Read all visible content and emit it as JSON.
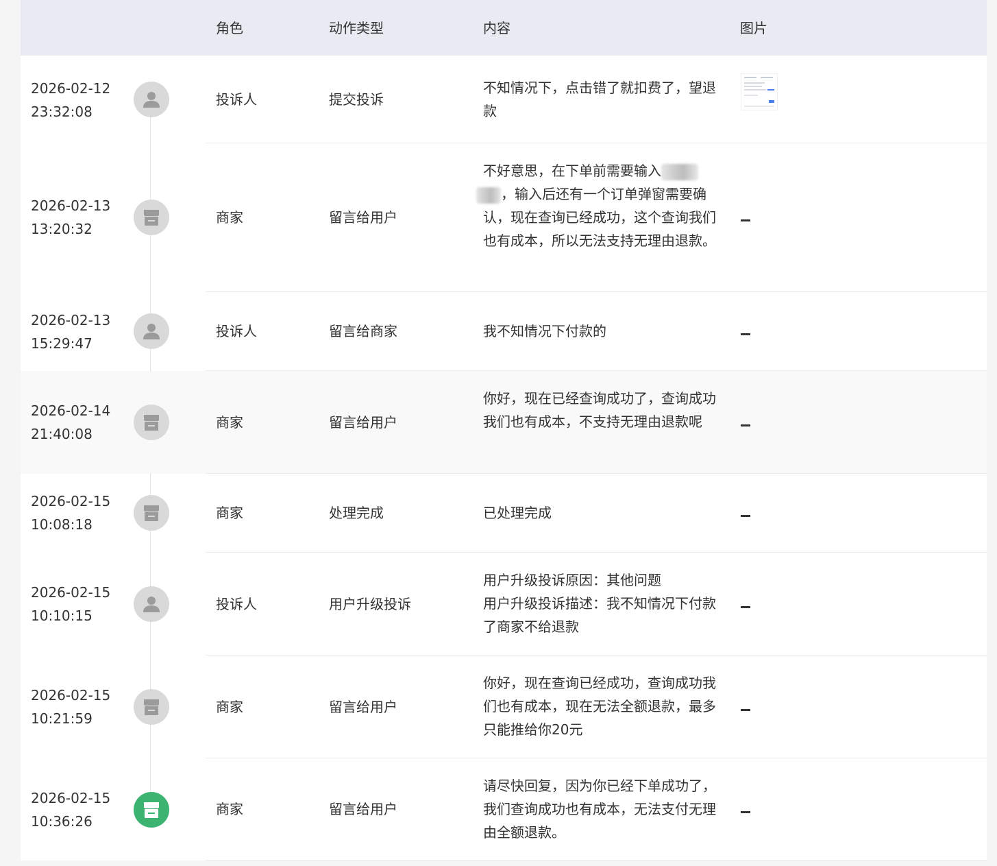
{
  "table": {
    "headers": [
      "角色",
      "动作类型",
      "内容",
      "图片"
    ]
  },
  "rows": [
    {
      "date": "2026-02-12",
      "time": "23:32:08",
      "avatar": "user-icon",
      "role": "投诉人",
      "action": "提交投诉",
      "content": "不知情况下，点击错了就扣费了，望退款",
      "image": "thumbnail"
    },
    {
      "date": "2026-02-13",
      "time": "13:20:32",
      "avatar": "store-icon",
      "role": "商家",
      "action": "留言给用户",
      "content_before": "不好意思，在下单前需要输入",
      "content_after": "，输入后还有一个订单弹窗需要确认，现在查询已经成功，这个查询我们也有成本，所以无法支持无理由退款。",
      "image": "–"
    },
    {
      "date": "2026-02-13",
      "time": "15:29:47",
      "avatar": "user-icon",
      "role": "投诉人",
      "action": "留言给商家",
      "content": "我不知情况下付款的",
      "image": "–"
    },
    {
      "date": "2026-02-14",
      "time": "21:40:08",
      "avatar": "store-icon",
      "role": "商家",
      "action": "留言给用户",
      "content": "你好，现在已经查询成功了，查询成功我们也有成本，不支持无理由退款呢",
      "image": "–"
    },
    {
      "date": "2026-02-15",
      "time": "10:08:18",
      "avatar": "store-icon",
      "role": "商家",
      "action": "处理完成",
      "content": "已处理完成",
      "image": "–"
    },
    {
      "date": "2026-02-15",
      "time": "10:10:15",
      "avatar": "user-icon",
      "role": "投诉人",
      "action": "用户升级投诉",
      "content_line1": "用户升级投诉原因：其他问题",
      "content_line2": "用户升级投诉描述：我不知情况下付款了商家不给退款",
      "image": "–"
    },
    {
      "date": "2026-02-15",
      "time": "10:21:59",
      "avatar": "store-icon",
      "role": "商家",
      "action": "留言给用户",
      "content": "你好，现在查询已经成功，查询成功我们也有成本，现在无法全额退款，最多只能推给你20元",
      "image": "–"
    },
    {
      "date": "2026-02-15",
      "time": "10:36:26",
      "avatar": "store-icon-active",
      "role": "商家",
      "action": "留言给用户",
      "content": "请尽快回复，因为你已经下单成功了，我们查询成功也有成本，无法支付无理由全额退款。",
      "image": "–"
    }
  ],
  "colors": {
    "header_bg": "#e8ebf2",
    "avatar_inactive": "#d9d9d9",
    "avatar_active": "#3cb371",
    "icon_gray": "#9b9b9b"
  }
}
